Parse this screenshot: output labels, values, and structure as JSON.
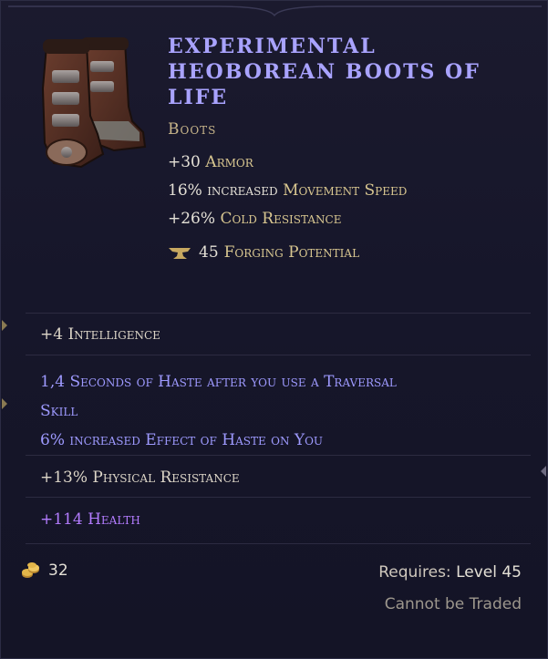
{
  "item": {
    "name": "Experimental Heoborean Boots of Life",
    "type": "Boots",
    "image_icon": "boots-icon"
  },
  "implicits": [
    {
      "value": "+30",
      "stat": "Armor"
    },
    {
      "value": "16% increased",
      "stat": "Movement Speed"
    },
    {
      "value": "+26%",
      "stat": "Cold Resistance"
    }
  ],
  "forging": {
    "icon": "anvil-icon",
    "value": "45",
    "label": "Forging Potential"
  },
  "affixes": [
    {
      "text": "+4 Intelligence"
    },
    {
      "line1": "1,4 Seconds of Haste after you use a Traversal",
      "line2": "Skill",
      "line3": "6% increased Effect of Haste on You"
    },
    {
      "text": "+13% Physical Resistance"
    },
    {
      "text": "+114 Health"
    }
  ],
  "footer": {
    "gold_icon": "gold-coins-icon",
    "gold_value": "32",
    "requires_label": "Requires:",
    "requires_level": "Level 45",
    "trade_status": "Cannot be Traded"
  },
  "colors": {
    "title": "#a9a3ff",
    "type": "#c8b58a",
    "affix_blue": "#9e9aff",
    "affix_purple": "#b37cff",
    "background": "#16162a"
  }
}
